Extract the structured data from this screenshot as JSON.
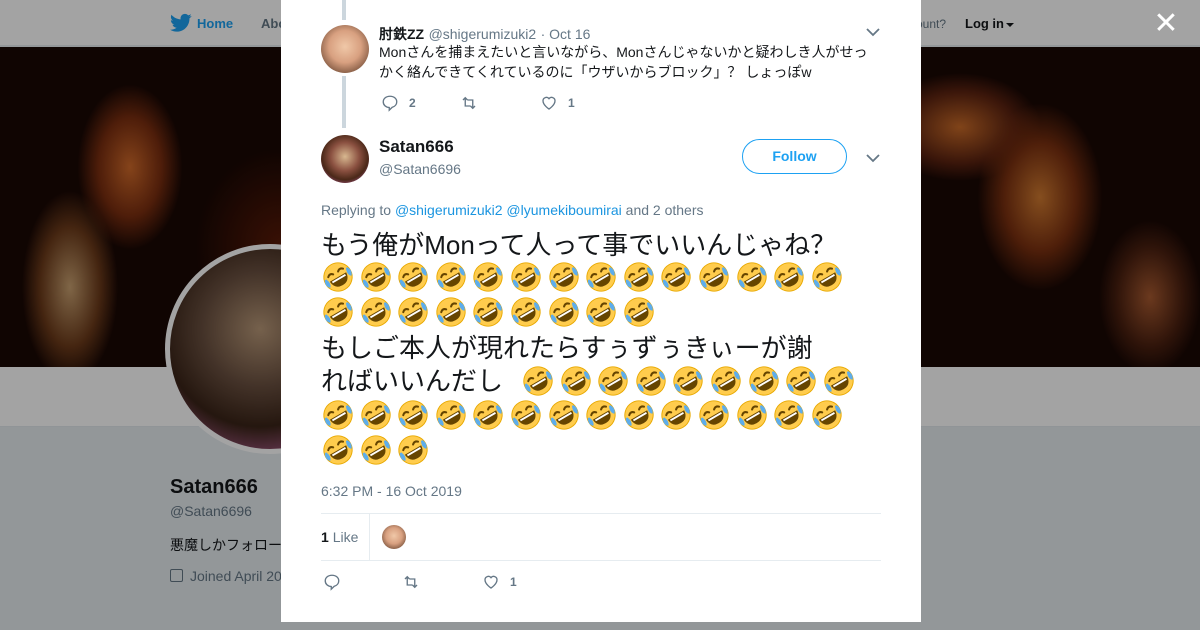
{
  "nav": {
    "home": "Home",
    "about": "Abo",
    "account": "ccount?",
    "login": "Log in"
  },
  "profile": {
    "name": "Satan666",
    "handle": "@Satan6696",
    "bio": "悪魔しかフォロー",
    "joined": "Joined April 20"
  },
  "reply_tweet": {
    "name": "肘鉄ZZ",
    "handle": "@shigerumizuki2",
    "date": "· Oct 16",
    "text": "Monさんを捕まえたいと言いながら、Monさんじゃないかと疑わしき人がせっかく絡んできてくれているのに「ウザいからブロック」？ しょっぽw",
    "replies": "2",
    "likes": "1"
  },
  "main_tweet": {
    "name": "Satan666",
    "handle": "@Satan6696",
    "follow_label": "Follow",
    "replying_to_label": "Replying to",
    "mention_1": "@shigerumizuki2",
    "mention_2": "@lyumekiboumirai",
    "others": "and 2 others",
    "line_1": "もう俺がMonって人って事でいいんじゃね？",
    "line_2": "もしご本人が現れたらすぅずぅきぃーが謝",
    "line_3": "ればいいんだし",
    "emoji": "rolling-on-floor-laughing",
    "timestamp": "6:32 PM - 16 Oct 2019",
    "like_count": "1",
    "like_label": "Like",
    "action_likes": "1"
  }
}
